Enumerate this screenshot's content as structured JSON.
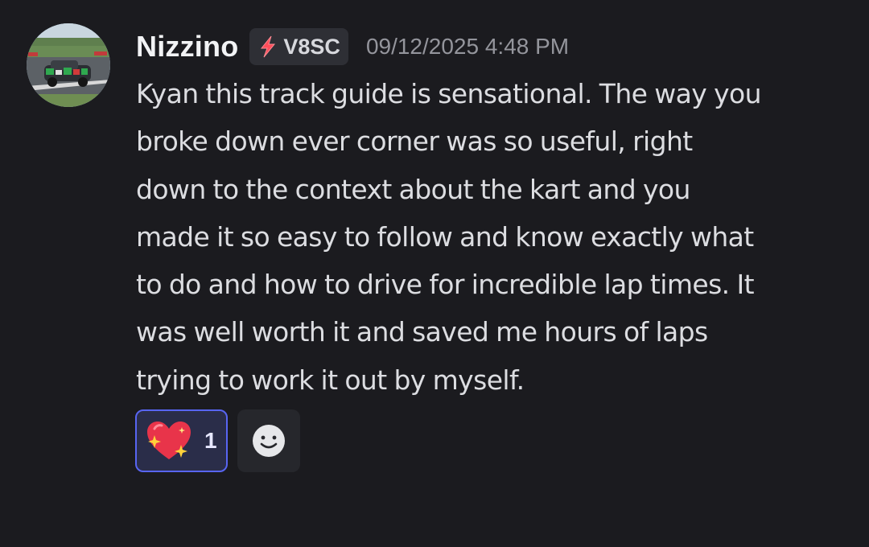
{
  "message": {
    "author": "Nizzino",
    "tag": {
      "label": "V8SC",
      "icon": "lightning-bolt-icon"
    },
    "timestamp": "09/12/2025 4:48 PM",
    "avatar": "race-car-photo",
    "content_lines": [
      "Kyan this track guide is sensational. The way you",
      "broke down ever corner was so useful, right",
      "down to the context about the kart and you",
      "made it so easy to follow and know exactly what",
      "to do and how to drive for incredible lap times. It",
      "was well worth it and saved me hours of laps",
      "trying to work it out by myself."
    ]
  },
  "reactions": [
    {
      "emoji": "sparkling-heart-icon",
      "count": "1",
      "selected": true
    }
  ],
  "add_reaction": {
    "icon": "add-reaction-smiley-icon"
  },
  "colors": {
    "background": "#1b1b1f",
    "text": "#dcdde1",
    "username": "#f2f3f5",
    "timestamp": "#94959c",
    "tag_bg": "#2e2f35",
    "reaction_bg": "#2a2d49",
    "reaction_border": "#5865f2",
    "lightning": "#ff4d5a"
  }
}
